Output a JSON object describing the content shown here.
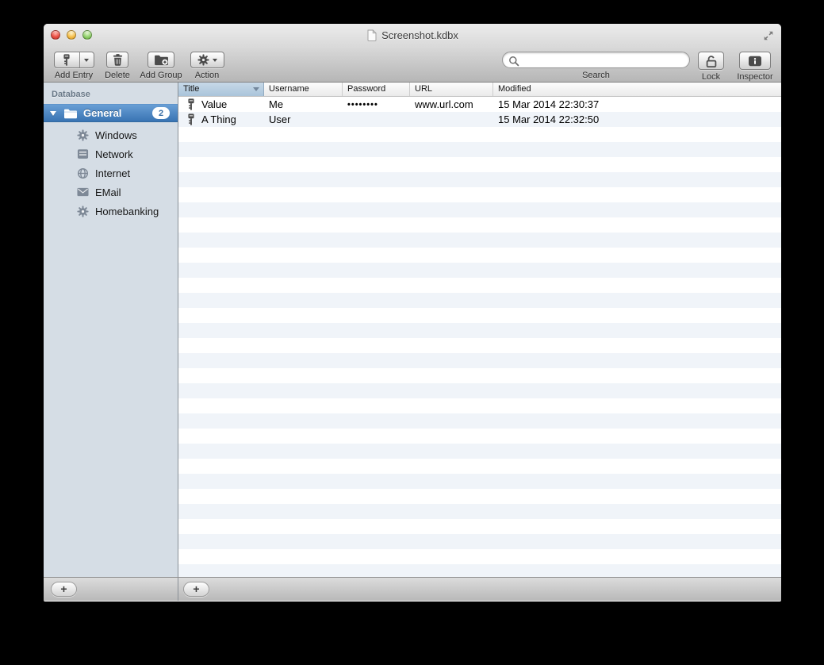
{
  "window": {
    "title": "Screenshot.kdbx"
  },
  "toolbar": {
    "add_entry": {
      "label": "Add Entry",
      "icon": "key-icon",
      "has_dropdown": true
    },
    "delete": {
      "label": "Delete",
      "icon": "trash-icon"
    },
    "add_group": {
      "label": "Add Group",
      "icon": "folder-add-icon"
    },
    "action": {
      "label": "Action",
      "icon": "gear-icon",
      "has_dropdown": true
    },
    "search": {
      "label": "Search",
      "value": "",
      "icon": "magnifier-icon"
    },
    "lock": {
      "label": "Lock",
      "icon": "lock-open-icon"
    },
    "inspector": {
      "label": "Inspector",
      "icon": "inspector-icon"
    }
  },
  "sidebar": {
    "header": "Database",
    "group": {
      "label": "General",
      "badge": "2",
      "icon": "folder-icon",
      "expanded": true,
      "selected": true
    },
    "items": [
      {
        "label": "Windows",
        "icon": "gear-icon"
      },
      {
        "label": "Network",
        "icon": "server-icon"
      },
      {
        "label": "Internet",
        "icon": "globe-icon"
      },
      {
        "label": "EMail",
        "icon": "envelope-icon"
      },
      {
        "label": "Homebanking",
        "icon": "gear-icon"
      }
    ],
    "add_button_label": "+"
  },
  "table": {
    "columns": [
      {
        "label": "Title",
        "sorted": true
      },
      {
        "label": "Username"
      },
      {
        "label": "Password"
      },
      {
        "label": "URL"
      },
      {
        "label": "Modified"
      }
    ],
    "rows": [
      {
        "icon": "key-icon",
        "title": "Value",
        "username": "Me",
        "password": "••••••••",
        "url": "www.url.com",
        "modified": "15 Mar 2014 22:30:37"
      },
      {
        "icon": "key-icon",
        "title": "A Thing",
        "username": "User",
        "password": "",
        "url": "",
        "modified": "15 Mar 2014 22:32:50"
      }
    ],
    "add_button_label": "+"
  },
  "colors": {
    "selection_blue_top": "#689ed5",
    "selection_blue_bottom": "#3974b3",
    "row_stripe": "#f0f4f9",
    "sidebar_bg": "#d5dde5",
    "sorted_header_top": "#c7d9e8",
    "sorted_header_bottom": "#aac4da",
    "badge_text": "#3a6ea5"
  }
}
